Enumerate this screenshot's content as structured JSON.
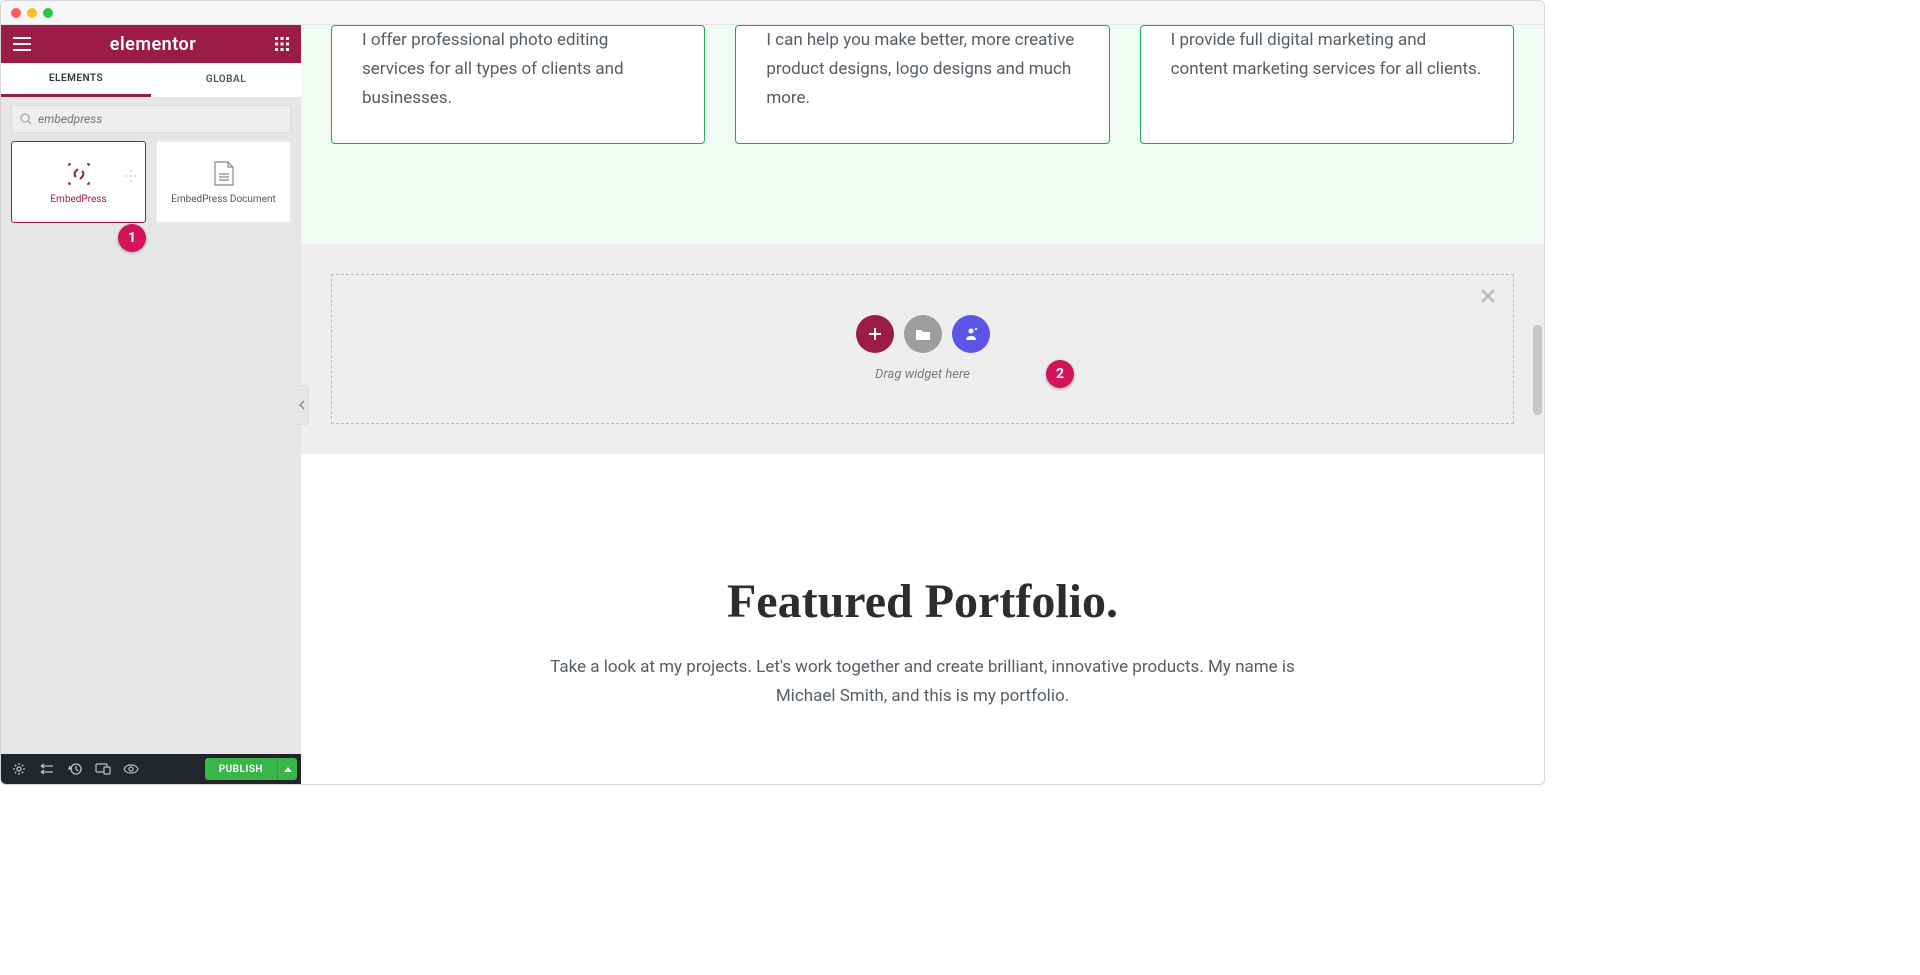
{
  "app": {
    "logo": "elementor"
  },
  "sidebar": {
    "tabs": {
      "elements": "ELEMENTS",
      "global": "GLOBAL"
    },
    "search": {
      "placeholder": "embedpress"
    },
    "widgets": {
      "embedpress": "EmbedPress",
      "embedpress_document": "EmbedPress Document"
    },
    "footer": {
      "publish": "PUBLISH"
    }
  },
  "content": {
    "services": {
      "card1": "I offer professional photo editing services for all types of clients and businesses.",
      "card2": "I can help you make better, more creative product designs, logo designs and much more.",
      "card3": "I provide full digital marketing and content marketing services for all clients."
    },
    "dropzone": {
      "hint": "Drag widget here"
    },
    "portfolio": {
      "title": "Featured Portfolio.",
      "desc": "Take a look at my projects. Let's work together and create brilliant, innovative products. My name is Michael Smith, and this is my portfolio."
    }
  },
  "annotations": {
    "b1": "1",
    "b2": "2"
  }
}
